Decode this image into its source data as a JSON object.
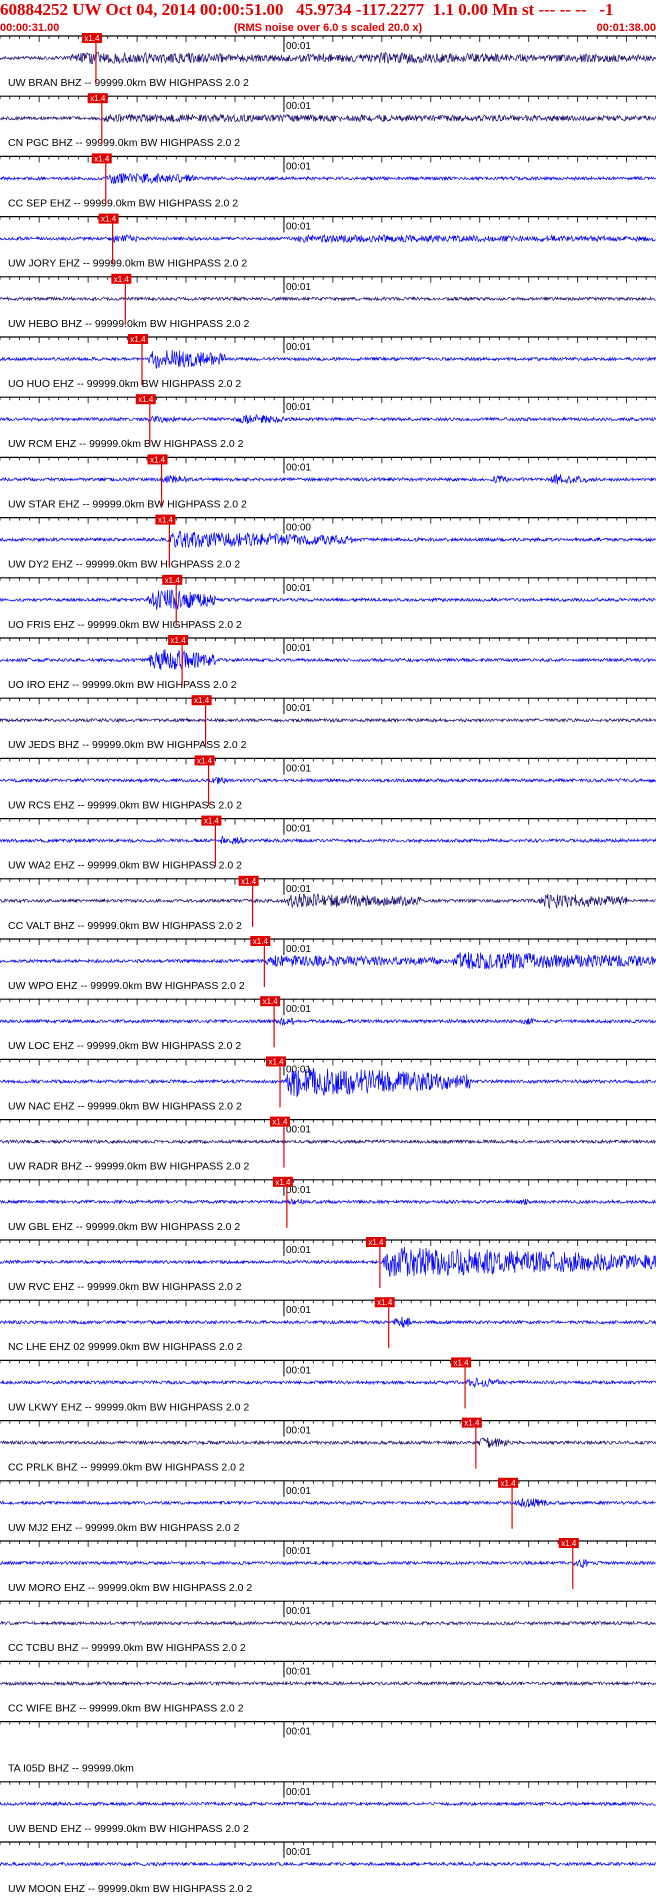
{
  "header": {
    "title": "60884252 UW Oct 04, 2014 00:00:51.00   45.9734 -117.2277  1.1 0.00 Mn st --- -- --   -1",
    "start_time": "00:00:31.00",
    "rms_note": "(RMS noise over 6.0 s scaled 20.0 x)",
    "end_time": "00:01:38.00"
  },
  "chart_data": {
    "type": "line",
    "x_unit": "seconds after 00:00:31.00",
    "x_range": [
      0,
      67
    ],
    "minute_tick_label": "00:01",
    "minute_tick_label_alt": "00:00",
    "pick_label": "x1.4",
    "colors": {
      "trace_dark": "#1a1070",
      "trace_blue": "#0000ff",
      "pick": "#e00000",
      "axis": "#000000"
    },
    "traces": [
      {
        "label": "UW BRAN BHZ -- 99999.0km BW  HIGHPASS  2.0  2",
        "color": "dark",
        "pick_s": 9.8,
        "bursts": [
          [
            7,
            30,
            3
          ],
          [
            30,
            45,
            2
          ],
          [
            38,
            60,
            2.5
          ],
          [
            58,
            67,
            2
          ]
        ]
      },
      {
        "label": "CN PGC BHZ -- 99999.0km BW  HIGHPASS  2.0  2",
        "color": "dark",
        "pick_s": 10.4,
        "bursts": [
          [
            10,
            67,
            1.5
          ]
        ]
      },
      {
        "label": "CC SEP EHZ -- 99999.0km BW  HIGHPASS  2.0  2",
        "color": "blue",
        "pick_s": 10.8,
        "bursts": [
          [
            10.8,
            20,
            3
          ]
        ]
      },
      {
        "label": "UW JORY EHZ -- 99999.0km BW  HIGHPASS  2.0  2",
        "color": "blue",
        "pick_s": 11.5,
        "bursts": [
          [
            11,
            14,
            2
          ],
          [
            30,
            67,
            1.5
          ]
        ]
      },
      {
        "label": "UW HEBO BHZ -- 99999.0km BW  HIGHPASS  2.0  2",
        "color": "dark",
        "pick_s": 12.8,
        "bursts": []
      },
      {
        "label": "UO HUO EHZ -- 99999.0km BW  HIGHPASS  2.0  2",
        "color": "blue",
        "pick_s": 14.5,
        "bursts": [
          [
            15,
            23,
            6
          ]
        ]
      },
      {
        "label": "UW RCM EHZ -- 99999.0km BW  HIGHPASS  2.0  2",
        "color": "blue",
        "pick_s": 15.3,
        "bursts": [
          [
            15,
            18,
            2
          ],
          [
            24,
            29,
            2.5
          ]
        ]
      },
      {
        "label": "UW STAR EHZ -- 99999.0km BW  HIGHPASS  2.0  2",
        "color": "blue",
        "pick_s": 16.5,
        "bursts": [
          [
            16.5,
            19,
            2.5
          ],
          [
            50,
            52,
            2
          ],
          [
            56,
            60,
            3
          ]
        ]
      },
      {
        "label": "UW DY2 EHZ -- 99999.0km BW  HIGHPASS  2.0  2",
        "color": "blue",
        "pick_s": 17.3,
        "bursts": [
          [
            17,
            36,
            4.5
          ]
        ]
      },
      {
        "label": "UO FRIS EHZ -- 99999.0km BW  HIGHPASS  2.0  2",
        "color": "blue",
        "pick_s": 18.0,
        "bursts": [
          [
            15,
            22,
            7
          ]
        ]
      },
      {
        "label": "UO IRO EHZ -- 99999.0km BW  HIGHPASS  2.0  2",
        "color": "blue",
        "pick_s": 18.6,
        "bursts": [
          [
            15,
            22,
            7
          ]
        ]
      },
      {
        "label": "UW JEDS BHZ -- 99999.0km BW  HIGHPASS  2.0  2",
        "color": "dark",
        "pick_s": 21.0,
        "bursts": []
      },
      {
        "label": "UW RCS EHZ -- 99999.0km BW  HIGHPASS  2.0  2",
        "color": "blue",
        "pick_s": 21.3,
        "bursts": [
          [
            21.5,
            23,
            2.5
          ]
        ]
      },
      {
        "label": "UW WA2 EHZ -- 99999.0km BW  HIGHPASS  2.0  2",
        "color": "blue",
        "pick_s": 22.0,
        "bursts": [
          [
            22,
            25,
            2.5
          ]
        ]
      },
      {
        "label": "CC VALT BHZ -- 99999.0km BW  HIGHPASS  2.0  2",
        "color": "dark",
        "pick_s": 25.8,
        "bursts": [
          [
            29,
            43,
            4
          ],
          [
            55,
            64,
            4
          ]
        ]
      },
      {
        "label": "UW WPO EHZ -- 99999.0km BW  HIGHPASS  2.0  2",
        "color": "blue",
        "pick_s": 27.0,
        "bursts": [
          [
            27,
            45,
            3
          ],
          [
            46,
            67,
            5
          ]
        ]
      },
      {
        "label": "UW LOC EHZ -- 99999.0km BW  HIGHPASS  2.0  2",
        "color": "blue",
        "pick_s": 28.0,
        "bursts": [
          [
            28,
            30,
            2.5
          ],
          [
            53,
            55,
            2
          ]
        ]
      },
      {
        "label": "UW NAC EHZ -- 99999.0km BW  HIGHPASS  2.0  2",
        "color": "blue",
        "pick_s": 28.6,
        "bursts": [
          [
            29,
            48,
            9
          ]
        ]
      },
      {
        "label": "UW RADR BHZ -- 99999.0km BW  HIGHPASS  2.0  2",
        "color": "dark",
        "pick_s": 29.0,
        "bursts": []
      },
      {
        "label": "UW GBL EHZ -- 99999.0km BW  HIGHPASS  2.0  2",
        "color": "blue",
        "pick_s": 29.3,
        "bursts": [
          [
            29,
            31,
            2
          ],
          [
            53,
            54,
            2
          ]
        ]
      },
      {
        "label": "UW RVC EHZ -- 99999.0km BW  HIGHPASS  2.0  2",
        "color": "blue",
        "pick_s": 38.8,
        "bursts": [
          [
            39,
            67,
            9
          ]
        ]
      },
      {
        "label": "NC LHE EHZ 02 99999.0km BW  HIGHPASS  2.0  2",
        "color": "blue",
        "pick_s": 39.7,
        "bursts": [
          [
            40,
            42,
            4
          ]
        ]
      },
      {
        "label": "UW LKWY EHZ -- 99999.0km BW  HIGHPASS  2.0  2",
        "color": "blue",
        "pick_s": 47.5,
        "bursts": [
          [
            47.5,
            51,
            2.5
          ]
        ]
      },
      {
        "label": "CC PRLK BHZ -- 99999.0km BW  HIGHPASS  2.0  2",
        "color": "dark",
        "pick_s": 48.6,
        "bursts": [
          [
            48.6,
            52,
            3
          ]
        ]
      },
      {
        "label": "UW MJ2 EHZ -- 99999.0km BW  HIGHPASS  2.0  2",
        "color": "blue",
        "pick_s": 52.3,
        "bursts": [
          [
            52.5,
            56,
            3
          ]
        ]
      },
      {
        "label": "UW MORO EHZ -- 99999.0km BW  HIGHPASS  2.0  2",
        "color": "blue",
        "pick_s": 58.5,
        "bursts": [
          [
            58.5,
            60,
            3.5
          ]
        ]
      },
      {
        "label": "CC TCBU BHZ -- 99999.0km BW  HIGHPASS  2.0  2",
        "color": "dark",
        "pick_s": null,
        "bursts": []
      },
      {
        "label": "CC WIFE BHZ -- 99999.0km BW  HIGHPASS  2.0  2",
        "color": "dark",
        "pick_s": null,
        "bursts": []
      },
      {
        "label": "TA I05D BHZ -- 99999.0km",
        "color": "none",
        "pick_s": null,
        "bursts": []
      },
      {
        "label": "UW BEND EHZ -- 99999.0km BW  HIGHPASS  2.0  2",
        "color": "blue",
        "pick_s": null,
        "bursts": []
      },
      {
        "label": "UW MOON EHZ -- 99999.0km BW  HIGHPASS  2.0  2",
        "color": "blue",
        "pick_s": null,
        "bursts": []
      }
    ]
  }
}
